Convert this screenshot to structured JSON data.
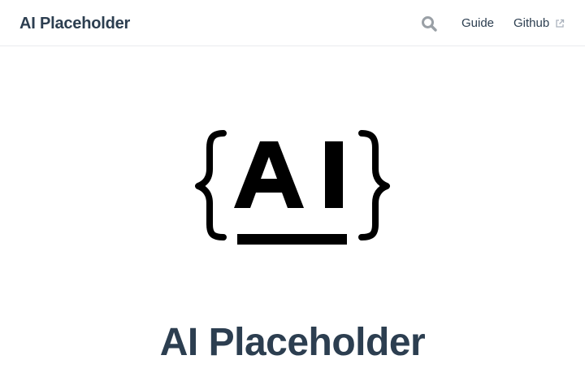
{
  "navbar": {
    "site_title": "AI Placeholder",
    "search_icon": "search-icon",
    "links": [
      {
        "label": "Guide"
      },
      {
        "label": "Github",
        "icon": "external-link-icon"
      }
    ]
  },
  "hero": {
    "logo_text": "AI",
    "logo_icon": "ai-braces-logo",
    "title": "AI Placeholder"
  },
  "colors": {
    "text": "#2c3e50",
    "muted_icon": "#9aa0a6",
    "border": "#eaecef",
    "logo": "#000000"
  }
}
